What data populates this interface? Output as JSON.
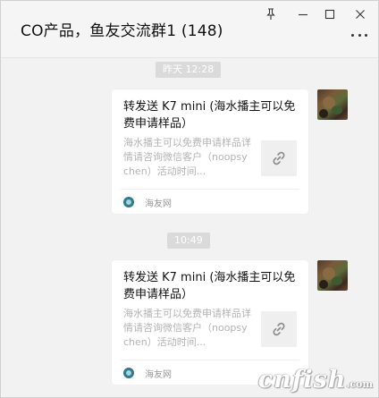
{
  "window": {
    "title": "CO产品，鱼友交流群1 (148)",
    "controls": [
      "pin-icon",
      "minimize-icon",
      "maximize-icon",
      "close-icon"
    ]
  },
  "messages": [
    {
      "time": "昨天 12:28",
      "card": {
        "title": "转发送 K7 mini (海水播主可以免费申请样品）",
        "description": "海水播主可以免费申请样品详情请咨询微信客户（noopsychen）活动时间...",
        "source": "海友网",
        "thumb_icon": "link-icon"
      }
    },
    {
      "time": "10:49",
      "card": {
        "title": "转发送 K7 mini (海水播主可以免费申请样品）",
        "description": "海水播主可以免费申请样品详情请咨询微信客户（noopsychen）活动时间...",
        "source": "海友网",
        "thumb_icon": "link-icon"
      }
    }
  ],
  "watermark": {
    "text": "cnfish",
    "suffix": ".com"
  },
  "colors": {
    "chat_bg": "#f2f2f2",
    "card_bg": "#ffffff",
    "time_chip": "#dadada",
    "source_icon": "#2f7a8f"
  }
}
